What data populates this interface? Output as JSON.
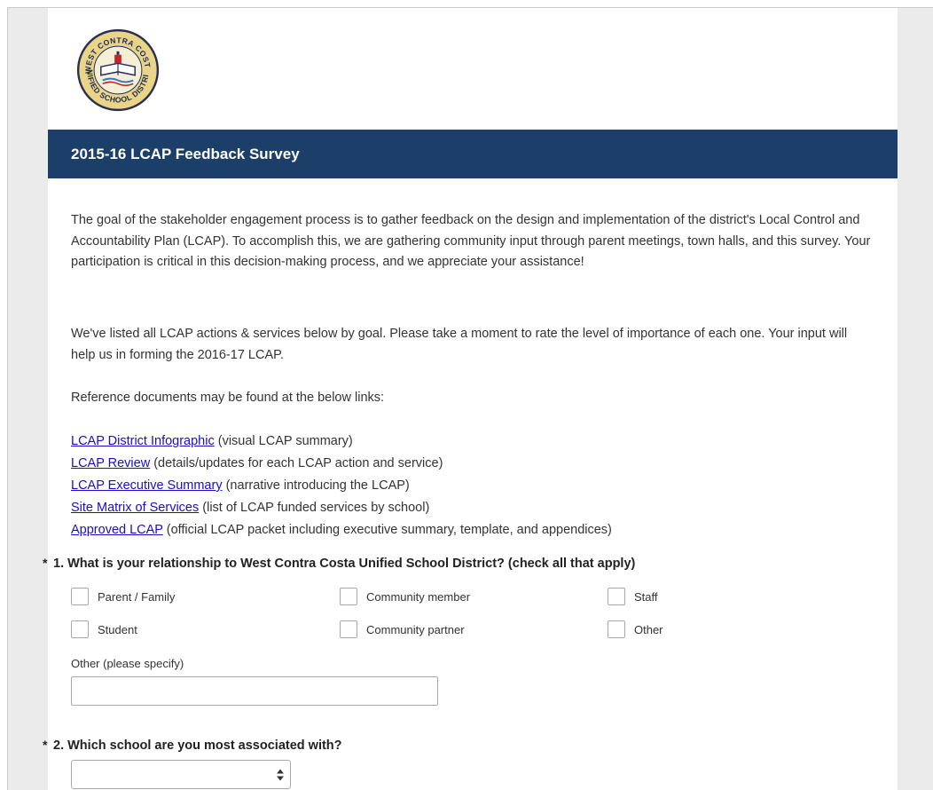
{
  "logo": {
    "text_top": "WEST CONTRA COSTA",
    "text_bottom": "UNIFIED SCHOOL DISTRICT",
    "colors": {
      "ring": "#e9d488",
      "navy": "#1d2b5c",
      "accent_red": "#c0252a"
    }
  },
  "survey": {
    "title": "2015-16 LCAP Feedback Survey",
    "title_bar_color": "#1b3f69",
    "intro_paragraph": "The goal of the stakeholder engagement process is to gather feedback on the design and implementation of the district's Local Control and Accountability Plan (LCAP). To accomplish this, we are gathering community input through parent meetings, town halls, and this survey. Your participation is critical in this decision-making process, and we appreciate your assistance!",
    "instructions_paragraph": "We've listed all LCAP actions & services below by goal. Please take a moment to rate the level of importance of each one. Your input will help us in forming the 2016-17 LCAP.",
    "reference_intro": "Reference documents may be found at the below links:",
    "links": [
      {
        "label": "LCAP District Infographic",
        "description": " (visual LCAP summary)"
      },
      {
        "label": "LCAP Review",
        "description": " (details/updates for each LCAP action and service)"
      },
      {
        "label": "LCAP Executive Summary",
        "description": " (narrative introducing the LCAP)"
      },
      {
        "label": "Site Matrix of Services",
        "description": " (list of LCAP funded services by school)"
      },
      {
        "label": "Approved LCAP",
        "description": " (official LCAP packet including executive summary, template, and appendices)"
      }
    ],
    "link_color": "#1a0dcc"
  },
  "question1": {
    "required_marker": "*",
    "text": "1. What is your relationship to West Contra Costa Unified School District? (check all that apply)",
    "options": [
      {
        "label": "Parent / Family",
        "checked": false
      },
      {
        "label": "Community member",
        "checked": false
      },
      {
        "label": "Staff",
        "checked": false
      },
      {
        "label": "Student",
        "checked": false
      },
      {
        "label": "Community partner",
        "checked": false
      },
      {
        "label": "Other",
        "checked": false
      }
    ],
    "other_label": "Other (please specify)",
    "other_value": ""
  },
  "question2": {
    "required_marker": "*",
    "text": "2. Which school are you most associated with?",
    "selected_value": ""
  }
}
